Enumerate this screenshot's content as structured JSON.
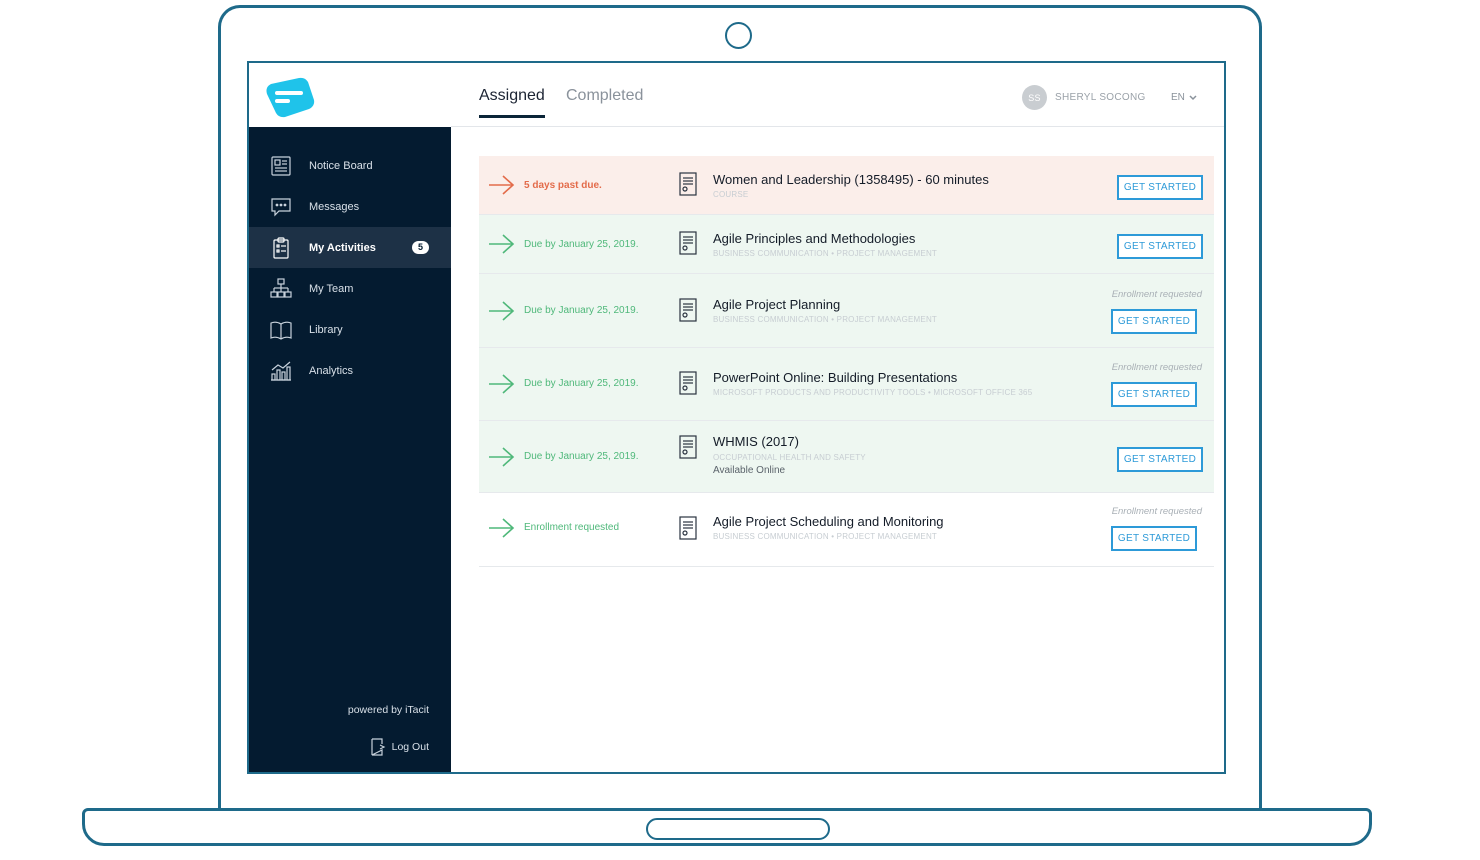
{
  "header": {
    "tabs": [
      {
        "label": "Assigned",
        "active": true
      },
      {
        "label": "Completed",
        "active": false
      }
    ],
    "user": {
      "initials": "SS",
      "name": "SHERYL SOCONG"
    },
    "language": "EN"
  },
  "sidebar": {
    "items": [
      {
        "label": "Notice Board",
        "icon": "notice-board-icon"
      },
      {
        "label": "Messages",
        "icon": "message-icon"
      },
      {
        "label": "My Activities",
        "icon": "clipboard-icon",
        "badge": "5",
        "active": true
      },
      {
        "label": "My Team",
        "icon": "org-chart-icon"
      },
      {
        "label": "Library",
        "icon": "book-icon"
      },
      {
        "label": "Analytics",
        "icon": "analytics-icon"
      }
    ],
    "powered_by": "powered by iTacit",
    "logout": "Log Out"
  },
  "activities": [
    {
      "due": "5 days past due.",
      "title": "Women and Leadership (1358495) - 60 minutes",
      "subtitle": "COURSE",
      "status": "overdue",
      "button": "GET STARTED"
    },
    {
      "due": "Due by January 25, 2019.",
      "title": "Agile Principles and Methodologies",
      "subtitle": "BUSINESS COMMUNICATION • PROJECT MANAGEMENT",
      "status": "due",
      "button": "GET STARTED"
    },
    {
      "due": "Due by January 25, 2019.",
      "title": "Agile Project Planning",
      "subtitle": "BUSINESS COMMUNICATION • PROJECT MANAGEMENT",
      "note": "Enrollment requested",
      "status": "due",
      "button": "GET STARTED"
    },
    {
      "due": "Due by January 25, 2019.",
      "title": "PowerPoint Online: Building Presentations",
      "subtitle": "MICROSOFT PRODUCTS AND PRODUCTIVITY TOOLS • MICROSOFT OFFICE 365",
      "note": "Enrollment requested",
      "status": "due",
      "button": "GET STARTED"
    },
    {
      "due": "Due by January 25, 2019.",
      "title": "WHMIS (2017)",
      "subtitle": "OCCUPATIONAL HEALTH AND SAFETY",
      "extra": "Available Online",
      "status": "due",
      "button": "GET STARTED"
    },
    {
      "due": "Enrollment requested",
      "title": "Agile Project Scheduling and Monitoring",
      "subtitle": "BUSINESS COMMUNICATION • PROJECT MANAGEMENT",
      "note": "Enrollment requested",
      "status": "plain",
      "button": "GET STARTED"
    }
  ],
  "colors": {
    "sidebar": "#041b30",
    "accent": "#2d9ad8",
    "overdue": "#e36b4a",
    "due": "#4fb87a",
    "logo": "#1fc3ea"
  }
}
